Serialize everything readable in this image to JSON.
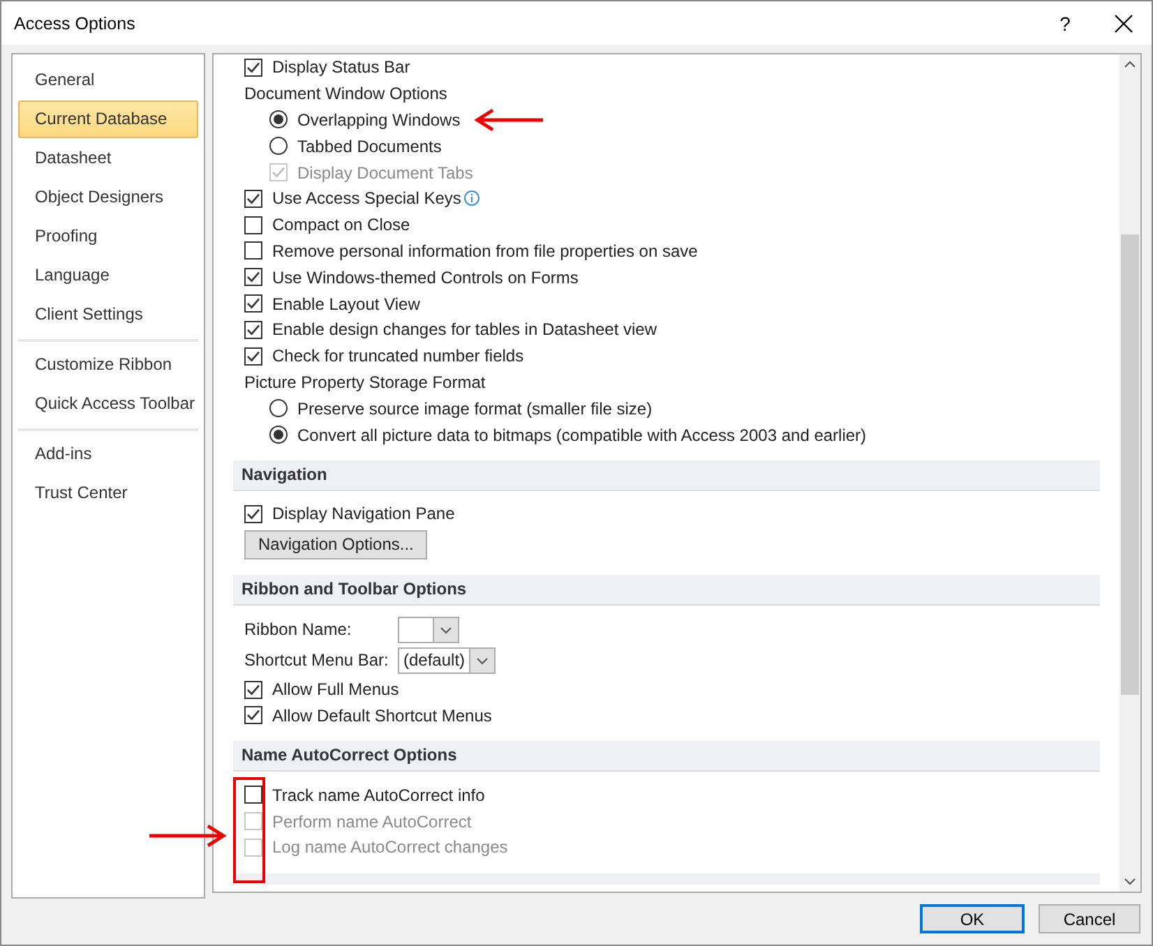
{
  "window": {
    "title": "Access Options",
    "help": "?"
  },
  "sidebar": {
    "groups": [
      {
        "items": [
          {
            "label": "General",
            "selected": false
          },
          {
            "label": "Current Database",
            "selected": true
          },
          {
            "label": "Datasheet",
            "selected": false
          },
          {
            "label": "Object Designers",
            "selected": false
          },
          {
            "label": "Proofing",
            "selected": false
          },
          {
            "label": "Language",
            "selected": false
          },
          {
            "label": "Client Settings",
            "selected": false
          }
        ]
      },
      {
        "items": [
          {
            "label": "Customize Ribbon",
            "selected": false
          },
          {
            "label": "Quick Access Toolbar",
            "selected": false
          }
        ]
      },
      {
        "items": [
          {
            "label": "Add-ins",
            "selected": false
          },
          {
            "label": "Trust Center",
            "selected": false
          }
        ]
      }
    ]
  },
  "content": {
    "sections": [
      {
        "items": [
          {
            "kind": "checkbox",
            "label": "Display Status Bar",
            "checked": true,
            "disabled": false
          },
          {
            "kind": "label",
            "label": "Document Window Options",
            "children": [
              {
                "kind": "radio",
                "label": "Overlapping Windows",
                "selected": true
              },
              {
                "kind": "radio",
                "label": "Tabbed Documents",
                "selected": false
              },
              {
                "kind": "checkbox",
                "label": "Display Document Tabs",
                "checked": true,
                "disabled": true
              }
            ]
          },
          {
            "kind": "checkbox",
            "label": "Use Access Special Keys",
            "checked": true,
            "disabled": false,
            "info": true
          },
          {
            "kind": "checkbox",
            "label": "Compact on Close",
            "checked": false,
            "disabled": false
          },
          {
            "kind": "checkbox",
            "label": "Remove personal information from file properties on save",
            "checked": false,
            "disabled": false
          },
          {
            "kind": "checkbox",
            "label": "Use Windows-themed Controls on Forms",
            "checked": true,
            "disabled": false
          },
          {
            "kind": "checkbox",
            "label": "Enable Layout View",
            "checked": true,
            "disabled": false
          },
          {
            "kind": "checkbox",
            "label": "Enable design changes for tables in Datasheet view",
            "checked": true,
            "disabled": false
          },
          {
            "kind": "checkbox",
            "label": "Check for truncated number fields",
            "checked": true,
            "disabled": false
          },
          {
            "kind": "label",
            "label": "Picture Property Storage Format",
            "children": [
              {
                "kind": "radio",
                "label": "Preserve source image format (smaller file size)",
                "selected": false
              },
              {
                "kind": "radio",
                "label": "Convert all picture data to bitmaps (compatible with Access 2003 and earlier)",
                "selected": true
              }
            ]
          }
        ]
      },
      {
        "title": "Navigation",
        "items": [
          {
            "kind": "checkbox",
            "label": "Display Navigation Pane",
            "checked": true,
            "disabled": false
          },
          {
            "kind": "button",
            "label": "Navigation Options..."
          }
        ]
      },
      {
        "title": "Ribbon and Toolbar Options",
        "items": [
          {
            "kind": "dropdown",
            "label": "Ribbon Name:"
          },
          {
            "kind": "dropdown",
            "label": "Shortcut Menu Bar:",
            "value": "(default)"
          },
          {
            "kind": "checkbox",
            "label": "Allow Full Menus",
            "checked": true,
            "disabled": false
          },
          {
            "kind": "checkbox",
            "label": "Allow Default Shortcut Menus",
            "checked": true,
            "disabled": false
          }
        ]
      },
      {
        "title": "Name AutoCorrect Options",
        "items": [
          {
            "kind": "checkbox",
            "label": "Track name AutoCorrect info",
            "checked": false,
            "disabled": false
          },
          {
            "kind": "checkbox",
            "label": "Perform name AutoCorrect",
            "checked": false,
            "disabled": true
          },
          {
            "kind": "checkbox",
            "label": "Log name AutoCorrect changes",
            "checked": false,
            "disabled": true
          }
        ]
      }
    ]
  },
  "buttons": [
    {
      "label": "OK",
      "default": true
    },
    {
      "label": "Cancel",
      "default": false
    }
  ]
}
